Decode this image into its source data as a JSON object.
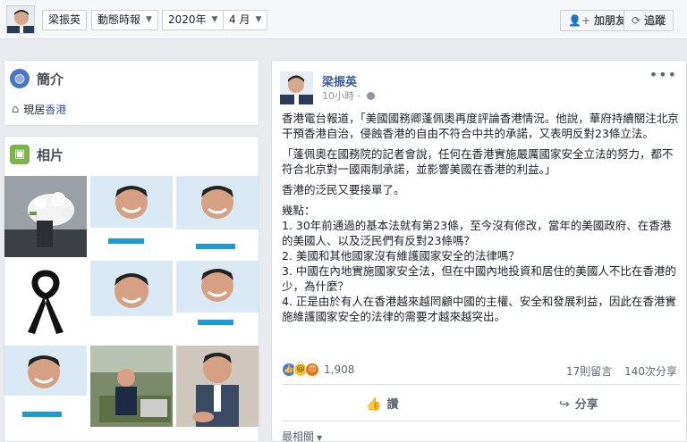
{
  "topbar": {
    "name": "梁振英",
    "filter_label": "動態時報",
    "year": "2020年",
    "month": "4 月",
    "add_friend_label": "加朋友",
    "follow_label": "追蹤",
    "add_friend_icon": "person-plus-icon",
    "follow_icon": "rss-icon"
  },
  "intro": {
    "title": "簡介",
    "lives_in_prefix": "現居",
    "lives_in_place": "香港"
  },
  "photos": {
    "title": "相片"
  },
  "post": {
    "author": "梁振英",
    "time": "10小時",
    "more": "•••",
    "paragraphs": [
      "香港電台報道，「美國國務卿蓬佩奧再度評論香港情況。他說，華府持續關注北京干預香港自治，侵蝕香港的自由不符合中共的承諾，又表明反對23條立法。",
      "「蓬佩奧在國務院的記者會說，任何在香港實施嚴厲國家安全立法的努力，都不符合北京對一國兩制承諾，並影響美國在香港的利益。」",
      "香港的泛民又要接單了。"
    ],
    "points_title": "幾點：",
    "points": [
      "1. 30年前通過的基本法就有第23條，至今沒有修改，當年的美國政府、在香港的美國人、以及泛民們有反對23條嗎？",
      "2. 美國和其他國家沒有維護國家安全的法律嗎？",
      "3. 中國在內地實施國家安全法，但在中國內地投資和居住的美國人不比在香港的少，為什麼？",
      "4. 正是由於有人在香港越來越罔顧中國的主權、安全和發展利益，因此在香港實施維護國家安全的法律的需要才越來越突出。"
    ],
    "reaction_count": "1,908",
    "comments": "17則留言",
    "shares": "140次分享",
    "like_label": "讚",
    "share_label": "分享",
    "sort_label": "最相關"
  },
  "colors": {
    "link": "#365899",
    "like_blue": "#4a76e8",
    "background": "#e9ebee"
  }
}
